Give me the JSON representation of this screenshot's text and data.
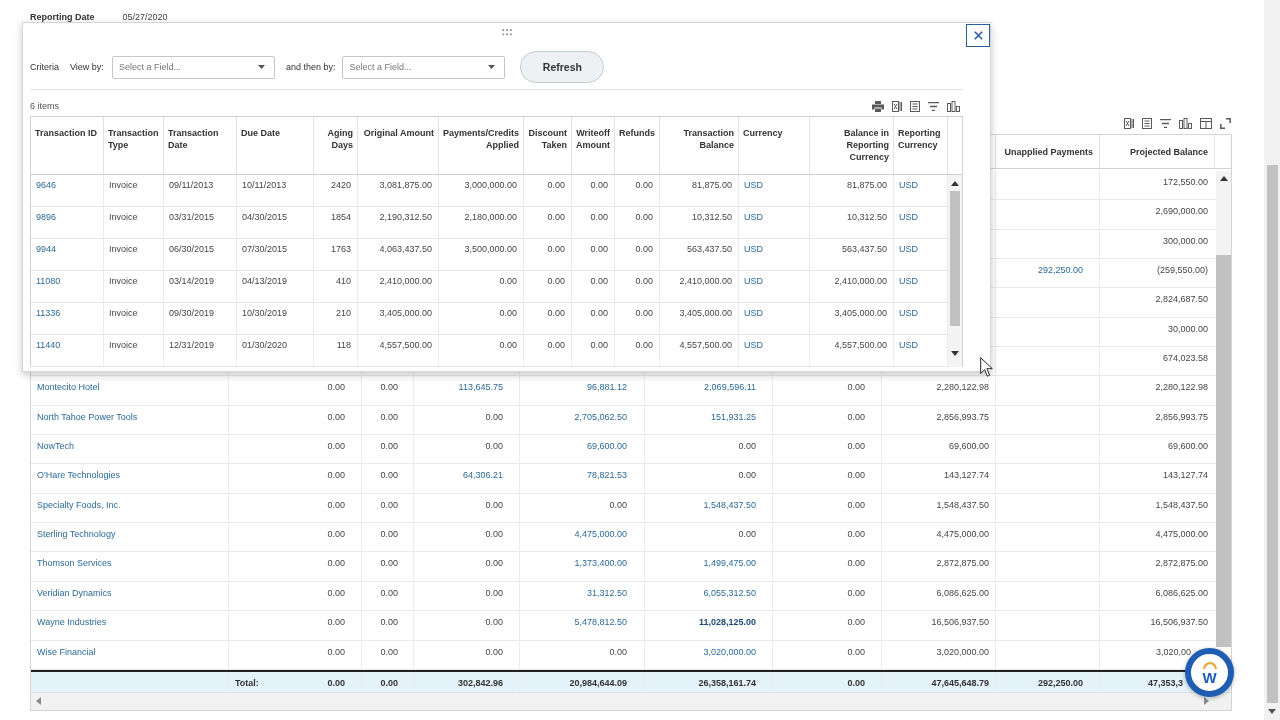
{
  "report_header": {
    "reporting_date_label": "Reporting Date",
    "reporting_date": "05/27/2020"
  },
  "report_table": {
    "headers": {
      "unapplied_payments": "Unapplied Payments",
      "projected_balance": "Projected Balance"
    },
    "rows": [
      {
        "projected_balance": {
          "text": "172,550.00",
          "kind": "plain"
        }
      },
      {
        "projected_balance": {
          "text": "2,690,000.00",
          "kind": "plain"
        }
      },
      {
        "projected_balance": {
          "text": "300,000.00",
          "kind": "plain"
        }
      },
      {
        "unapplied_payments": {
          "text": "292,250.00",
          "kind": "link"
        },
        "projected_balance": {
          "text": "(259,550.00)",
          "kind": "plain"
        }
      },
      {
        "projected_balance": {
          "text": "2,824,687.50",
          "kind": "plain"
        }
      },
      {
        "projected_balance": {
          "text": "30,000.00",
          "kind": "plain"
        }
      },
      {
        "projected_balance": {
          "text": "674,023.58",
          "kind": "plain"
        }
      },
      {
        "column_1": {
          "text": "Montecito Hotel",
          "kind": "link"
        },
        "column_2": {
          "text": "0.00",
          "kind": "plain"
        },
        "column_3": {
          "text": "0.00",
          "kind": "plain"
        },
        "column_4": {
          "text": "113,645.75",
          "kind": "link"
        },
        "column_5": {
          "text": "96,881.12",
          "kind": "link"
        },
        "column_6": {
          "text": "2,069,596.11",
          "kind": "link"
        },
        "column_7": {
          "text": "0.00",
          "kind": "plain"
        },
        "column_8": {
          "text": "2,280,122.98",
          "kind": "plain"
        },
        "projected_balance": {
          "text": "2,280,122.98",
          "kind": "plain"
        }
      },
      {
        "column_1": {
          "text": "North Tahoe Power Tools",
          "kind": "link"
        },
        "column_2": {
          "text": "0.00",
          "kind": "plain"
        },
        "column_3": {
          "text": "0.00",
          "kind": "plain"
        },
        "column_4": {
          "text": "0.00",
          "kind": "plain"
        },
        "column_5": {
          "text": "2,705,062.50",
          "kind": "link"
        },
        "column_6": {
          "text": "151,931.25",
          "kind": "link"
        },
        "column_7": {
          "text": "0.00",
          "kind": "plain"
        },
        "column_8": {
          "text": "2,856,993.75",
          "kind": "plain"
        },
        "projected_balance": {
          "text": "2,856,993.75",
          "kind": "plain"
        }
      },
      {
        "column_1": {
          "text": "NowTech",
          "kind": "link"
        },
        "column_2": {
          "text": "0.00",
          "kind": "plain"
        },
        "column_3": {
          "text": "0.00",
          "kind": "plain"
        },
        "column_4": {
          "text": "0.00",
          "kind": "plain"
        },
        "column_5": {
          "text": "69,600.00",
          "kind": "link"
        },
        "column_6": {
          "text": "0.00",
          "kind": "plain"
        },
        "column_7": {
          "text": "0.00",
          "kind": "plain"
        },
        "column_8": {
          "text": "69,600.00",
          "kind": "plain"
        },
        "projected_balance": {
          "text": "69,600.00",
          "kind": "plain"
        }
      },
      {
        "column_1": {
          "text": "O'Hare Technologies",
          "kind": "link"
        },
        "column_2": {
          "text": "0.00",
          "kind": "plain"
        },
        "column_3": {
          "text": "0.00",
          "kind": "plain"
        },
        "column_4": {
          "text": "64,306.21",
          "kind": "link"
        },
        "column_5": {
          "text": "78,821.53",
          "kind": "link"
        },
        "column_6": {
          "text": "0.00",
          "kind": "plain"
        },
        "column_7": {
          "text": "0.00",
          "kind": "plain"
        },
        "column_8": {
          "text": "143,127.74",
          "kind": "plain"
        },
        "projected_balance": {
          "text": "143,127.74",
          "kind": "plain"
        }
      },
      {
        "column_1": {
          "text": "Specialty Foods, Inc.",
          "kind": "link"
        },
        "column_2": {
          "text": "0.00",
          "kind": "plain"
        },
        "column_3": {
          "text": "0.00",
          "kind": "plain"
        },
        "column_4": {
          "text": "0.00",
          "kind": "plain"
        },
        "column_5": {
          "text": "0.00",
          "kind": "plain"
        },
        "column_6": {
          "text": "1,548,437.50",
          "kind": "link"
        },
        "column_7": {
          "text": "0.00",
          "kind": "plain"
        },
        "column_8": {
          "text": "1,548,437.50",
          "kind": "plain"
        },
        "projected_balance": {
          "text": "1,548,437.50",
          "kind": "plain"
        }
      },
      {
        "column_1": {
          "text": "Sterling Technology",
          "kind": "link"
        },
        "column_2": {
          "text": "0.00",
          "kind": "plain"
        },
        "column_3": {
          "text": "0.00",
          "kind": "plain"
        },
        "column_4": {
          "text": "0.00",
          "kind": "plain"
        },
        "column_5": {
          "text": "4,475,000.00",
          "kind": "link"
        },
        "column_6": {
          "text": "0.00",
          "kind": "plain"
        },
        "column_7": {
          "text": "0.00",
          "kind": "plain"
        },
        "column_8": {
          "text": "4,475,000.00",
          "kind": "plain"
        },
        "projected_balance": {
          "text": "4,475,000.00",
          "kind": "plain"
        }
      },
      {
        "column_1": {
          "text": "Thomson Services",
          "kind": "link"
        },
        "column_2": {
          "text": "0.00",
          "kind": "plain"
        },
        "column_3": {
          "text": "0.00",
          "kind": "plain"
        },
        "column_4": {
          "text": "0.00",
          "kind": "plain"
        },
        "column_5": {
          "text": "1,373,400.00",
          "kind": "link"
        },
        "column_6": {
          "text": "1,499,475.00",
          "kind": "link"
        },
        "column_7": {
          "text": "0.00",
          "kind": "plain"
        },
        "column_8": {
          "text": "2,872,875.00",
          "kind": "plain"
        },
        "projected_balance": {
          "text": "2,872,875.00",
          "kind": "plain"
        }
      },
      {
        "column_1": {
          "text": "Veridian Dynamics",
          "kind": "link"
        },
        "column_2": {
          "text": "0.00",
          "kind": "plain"
        },
        "column_3": {
          "text": "0.00",
          "kind": "plain"
        },
        "column_4": {
          "text": "0.00",
          "kind": "plain"
        },
        "column_5": {
          "text": "31,312.50",
          "kind": "link"
        },
        "column_6": {
          "text": "6,055,312.50",
          "kind": "link"
        },
        "column_7": {
          "text": "0.00",
          "kind": "plain"
        },
        "column_8": {
          "text": "6,086,625.00",
          "kind": "plain"
        },
        "projected_balance": {
          "text": "6,086,625.00",
          "kind": "plain"
        }
      },
      {
        "column_1": {
          "text": "Wayne Industries",
          "kind": "link"
        },
        "column_2": {
          "text": "0.00",
          "kind": "plain"
        },
        "column_3": {
          "text": "0.00",
          "kind": "plain"
        },
        "column_4": {
          "text": "0.00",
          "kind": "plain"
        },
        "column_5": {
          "text": "5,478,812.50",
          "kind": "link"
        },
        "column_6": {
          "text": "11,028,125.00",
          "kind": "bold_link"
        },
        "column_7": {
          "text": "0.00",
          "kind": "plain"
        },
        "column_8": {
          "text": "16,506,937.50",
          "kind": "plain"
        },
        "projected_balance": {
          "text": "16,506,937.50",
          "kind": "plain"
        }
      },
      {
        "column_1": {
          "text": "Wise Financial",
          "kind": "link"
        },
        "column_2": {
          "text": "0.00",
          "kind": "plain"
        },
        "column_3": {
          "text": "0.00",
          "kind": "plain"
        },
        "column_4": {
          "text": "0.00",
          "kind": "plain"
        },
        "column_5": {
          "text": "0.00",
          "kind": "plain"
        },
        "column_6": {
          "text": "3,020,000.00",
          "kind": "link"
        },
        "column_7": {
          "text": "0.00",
          "kind": "plain"
        },
        "column_8": {
          "text": "3,020,000.00",
          "kind": "plain"
        },
        "projected_balance": {
          "text": "3,020,00",
          "kind": "plain"
        }
      }
    ],
    "total": {
      "label": "Total:",
      "column_2": "0.00",
      "column_3": "0.00",
      "column_4": "302,842.96",
      "column_5": "20,984,644.09",
      "column_6": "26,358,161.74",
      "column_7": "0.00",
      "column_8": "47,645,648.79",
      "unapplied_payments": "292,250.00",
      "projected_balance": "47,353,3"
    }
  },
  "dialog": {
    "criteria_label": "Criteria",
    "view_by": {
      "label": "View by:",
      "placeholder": "Select a Field..."
    },
    "then_by": {
      "label": "and then by:",
      "placeholder": "Select a Field..."
    },
    "refresh_button": "Refresh",
    "item_count": "6 items",
    "columns": [
      {
        "label": "Transaction ID",
        "kind": "link"
      },
      {
        "label": "Transaction Type",
        "kind": "text"
      },
      {
        "label": "Transaction Date",
        "kind": "text"
      },
      {
        "label": "Due Date",
        "kind": "text"
      },
      {
        "label": "Aging Days",
        "kind": "number"
      },
      {
        "label": "Original Amount",
        "kind": "number"
      },
      {
        "label": "Payments/Credits Applied",
        "kind": "number"
      },
      {
        "label": "Discount Taken",
        "kind": "number"
      },
      {
        "label": "Writeoff Amount",
        "kind": "number"
      },
      {
        "label": "Refunds",
        "kind": "number"
      },
      {
        "label": "Transaction Balance",
        "kind": "number"
      },
      {
        "label": "Currency",
        "kind": "link"
      },
      {
        "label": "Balance in Reporting Currency",
        "kind": "number"
      },
      {
        "label": "Reporting Currency",
        "kind": "link"
      }
    ],
    "rows": [
      [
        "9646",
        "Invoice",
        "09/11/2013",
        "10/11/2013",
        "2420",
        "3,081,875.00",
        "3,000,000.00",
        "0.00",
        "0.00",
        "0.00",
        "81,875.00",
        "USD",
        "81,875.00",
        "USD"
      ],
      [
        "9896",
        "Invoice",
        "03/31/2015",
        "04/30/2015",
        "1854",
        "2,190,312.50",
        "2,180,000.00",
        "0.00",
        "0.00",
        "0.00",
        "10,312.50",
        "USD",
        "10,312.50",
        "USD"
      ],
      [
        "9944",
        "Invoice",
        "06/30/2015",
        "07/30/2015",
        "1763",
        "4,063,437.50",
        "3,500,000.00",
        "0.00",
        "0.00",
        "0.00",
        "563,437.50",
        "USD",
        "563,437.50",
        "USD"
      ],
      [
        "11080",
        "Invoice",
        "03/14/2019",
        "04/13/2019",
        "410",
        "2,410,000.00",
        "0.00",
        "0.00",
        "0.00",
        "0.00",
        "2,410,000.00",
        "USD",
        "2,410,000.00",
        "USD"
      ],
      [
        "11336",
        "Invoice",
        "09/30/2019",
        "10/30/2019",
        "210",
        "3,405,000.00",
        "0.00",
        "0.00",
        "0.00",
        "0.00",
        "3,405,000.00",
        "USD",
        "3,405,000.00",
        "USD"
      ],
      [
        "11440",
        "Invoice",
        "12/31/2019",
        "01/30/2020",
        "118",
        "4,557,500.00",
        "0.00",
        "0.00",
        "0.00",
        "0.00",
        "4,557,500.00",
        "USD",
        "4,557,500.00",
        "USD"
      ]
    ]
  },
  "help_chat": {
    "logo_letter": "W"
  }
}
